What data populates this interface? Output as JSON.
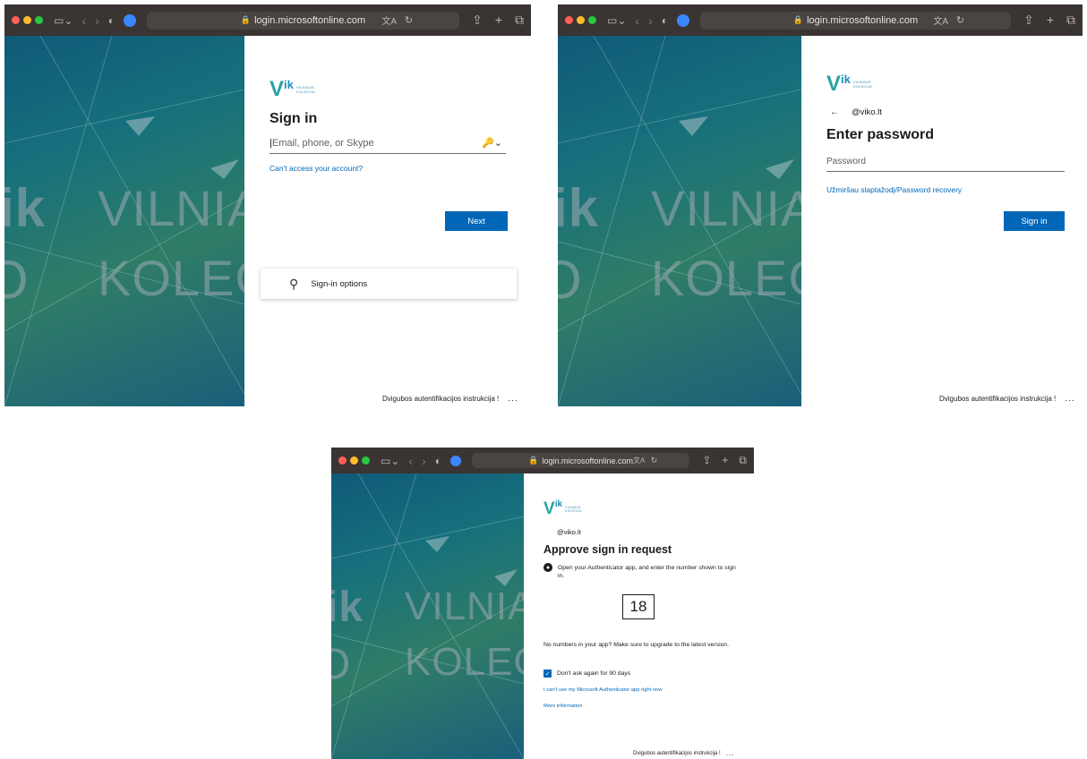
{
  "browser": {
    "url": "login.microsoftonline.com"
  },
  "background": {
    "word_top": "VILNIA",
    "word_bottom": "KOLEG",
    "letters_ik": "ik"
  },
  "logo": {
    "mark": "Vik",
    "line1": "VILNIAUS",
    "line2": "KOLEGIJA"
  },
  "footer": {
    "text": "Dvigubos autentifikacijos instrukcija !",
    "more": "..."
  },
  "signin_screen": {
    "title": "Sign in",
    "email_placeholder": "Email, phone, or Skype",
    "cant_access_link": "Can't access your account?",
    "next_button": "Next",
    "signin_options": "Sign-in options"
  },
  "password_screen": {
    "back_arrow": "←",
    "account": "@viko.lt",
    "title": "Enter password",
    "password_placeholder": "Password",
    "recovery_link": "Užmiršau slaptažodį/Password recovery",
    "signin_button": "Sign in"
  },
  "approve_screen": {
    "account": "@viko.lt",
    "title": "Approve sign in request",
    "instruction": "Open your Authenticator app, and enter the number shown to sign in.",
    "number": "18",
    "upgrade_note": "No numbers in your app? Make sure to upgrade to the latest version.",
    "dont_ask_label": "Don't ask again for 90 days",
    "dont_ask_checked": true,
    "cant_use_link": "I can't use my Microsoft Authenticator app right now",
    "more_info_link": "More information"
  }
}
